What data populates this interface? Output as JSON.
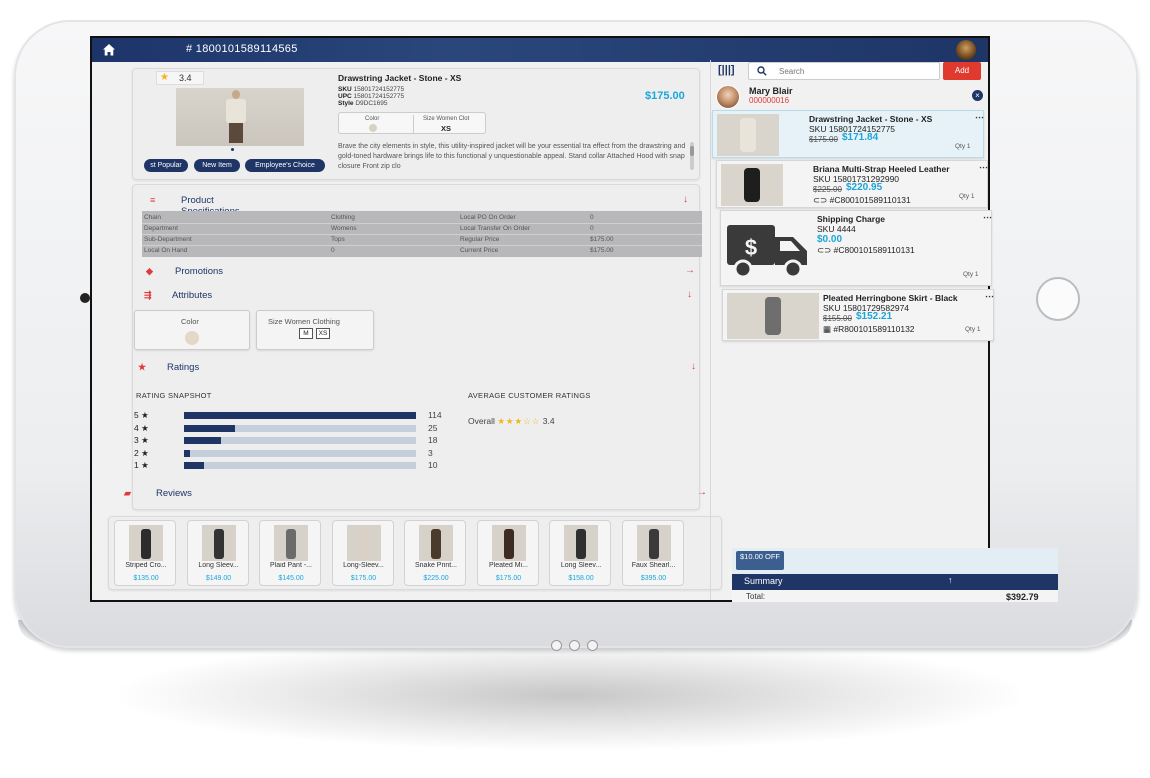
{
  "topbar": {
    "order_number": "# 1800101589114565"
  },
  "product": {
    "rating": "3.4",
    "name": "Drawstring Jacket - Stone - XS",
    "sku_label": "SKU",
    "sku": "15801724152775",
    "upc_label": "UPC",
    "upc": "15801724152775",
    "style_label": "Style",
    "style": "D9DC1695",
    "price": "$175.00",
    "color_label": "Color",
    "size_label": "Size Women Clot",
    "size_value": "XS",
    "badges": [
      "st Popular",
      "New Item",
      "Employee's Choice"
    ],
    "description": "Brave the city elements in style, this utility-inspired jacket will be your essential tra effect from the drawstring and gold-toned hardware brings life to this functional y unquestionable appeal. Stand collar Attached Hood with snap closure Front zip clo"
  },
  "sections": {
    "specs": "Product Specifications",
    "promotions": "Promotions",
    "attributes": "Attributes",
    "ratings": "Ratings",
    "reviews": "Reviews"
  },
  "specs": [
    {
      "label": "Chain",
      "value": "Clothing",
      "label2": "Local PO On Order",
      "value2": "0"
    },
    {
      "label": "Department",
      "value": "Womens",
      "label2": "Local Transfer On Order",
      "value2": "0"
    },
    {
      "label": "Sub-Department",
      "value": "Tops",
      "label2": "Regular Price",
      "value2": "$175.00"
    },
    {
      "label": "Local On Hand",
      "value": "0",
      "label2": "Current Price",
      "value2": "$175.00"
    }
  ],
  "attributes": {
    "color_label": "Color",
    "size_label": "Size Women Clothing",
    "sizes": [
      "M",
      "XS"
    ]
  },
  "ratings": {
    "snapshot_title": "RATING SNAPSHOT",
    "average_title": "AVERAGE CUSTOMER RATINGS",
    "overall_label": "Overall",
    "overall_stars": "★★★☆☆",
    "overall_value": "3.4",
    "bars": [
      {
        "label": "5 ★",
        "count": 114,
        "count_text": "114"
      },
      {
        "label": "4 ★",
        "count": 25,
        "count_text": "25"
      },
      {
        "label": "3 ★",
        "count": 18,
        "count_text": "18"
      },
      {
        "label": "2 ★",
        "count": 3,
        "count_text": "3"
      },
      {
        "label": "1 ★",
        "count": 10,
        "count_text": "10"
      }
    ]
  },
  "related": [
    {
      "name": "Striped Cro...",
      "price": "$135.00"
    },
    {
      "name": "Long Sleev...",
      "price": "$149.00"
    },
    {
      "name": "Plaid Pant -...",
      "price": "$145.00"
    },
    {
      "name": "Long-Sleev...",
      "price": "$175.00"
    },
    {
      "name": "Snake Print...",
      "price": "$225.00"
    },
    {
      "name": "Pleated Mi...",
      "price": "$175.00"
    },
    {
      "name": "Long Sleev...",
      "price": "$158.00"
    },
    {
      "name": "Faux Shearl...",
      "price": "$395.00"
    }
  ],
  "cart": {
    "search_placeholder": "Search",
    "add_label": "Add",
    "customer_name": "Mary Blair",
    "customer_id": "000000016",
    "items": [
      {
        "name": "Drawstring Jacket - Stone - XS",
        "sku": "SKU 15801724152775",
        "old": "$175.00",
        "new": "$171.84",
        "ref": "",
        "qty": "Qty 1"
      },
      {
        "name": "Briana Multi-Strap Heeled Leather",
        "sku": "SKU 15801731292990",
        "old": "$225.00",
        "new": "$220.95",
        "ref": "⊂⊃ #C800101589110131",
        "qty": "Qty 1"
      },
      {
        "name": "Shipping Charge",
        "sku": "SKU 4444",
        "old": "",
        "new": "$0.00",
        "ref": "⊂⊃ #C800101589110131",
        "qty": "Qty 1"
      },
      {
        "name": "Pleated Herringbone Skirt - Black",
        "sku": "SKU 15801729582974",
        "old": "$155.00",
        "new": "$152.21",
        "ref": "▦ #R800101589110132",
        "qty": "Qty 1"
      }
    ],
    "discount_chip": "$10.00 OFF",
    "summary_label": "Summary",
    "total_label": "Total:",
    "total_value": "$392.79"
  },
  "colors": {
    "navy": "#1e3566",
    "accent_blue": "#1aa6d9",
    "accent_red": "#e03a3a",
    "star": "#f2b51a"
  }
}
